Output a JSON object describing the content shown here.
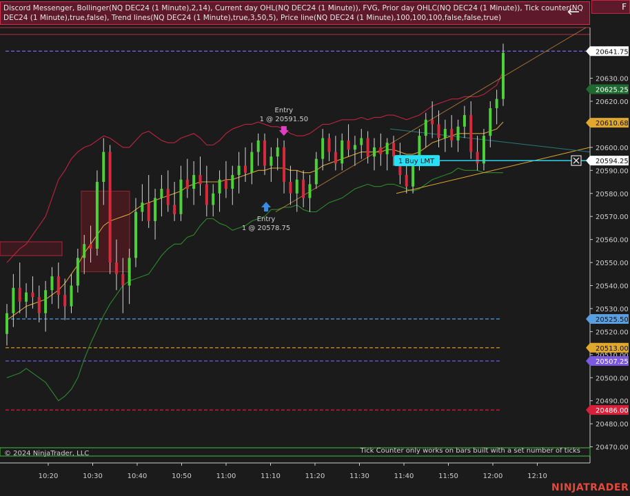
{
  "indicator_bar": {
    "text": "Discord Messenger, Bollinger(NQ DEC24 (1 Minute),2,14), Current day OHL(NQ DEC24 (1 Minute)), FVG, Prior day OHLC(NQ DEC24 (1 Minute)), Tick counter(NQ DEC24 (1 Minute),true,false), Trend lines(NQ DEC24 (1 Minute),true,3,50,5), Price line(NQ DEC24 (1 Minute),100,100,100,false,false,true)"
  },
  "corner_button": {
    "label": "F"
  },
  "back_button": {
    "icon": "arrow-left-icon"
  },
  "copyright": "© 2024 NinjaTrader, LLC",
  "tick_counter_note": "Tick Counter only works on bars built with a set number of ticks",
  "brand": "NINJATRADER",
  "colors": {
    "background": "#1b1b1b",
    "up": "#4cd137",
    "down": "#d62b3d",
    "wick": "#d8d8d8",
    "bb_upper": "#c0243f",
    "bb_mid": "#d4a23a",
    "bb_lower": "#2c8a2c",
    "price_tag": "#ffffff",
    "green_tag": "#1f5e2c",
    "gold_tag": "#e0a82e",
    "blue_tag": "#5aa0e0",
    "purple_tag": "#7b5ae0",
    "red_tag": "#d8203a"
  },
  "chart_data": {
    "type": "candlestick",
    "instrument": "NQ DEC24 (1 Minute)",
    "y_ticks": [
      20470,
      20480,
      20490,
      20500,
      20510,
      20520,
      20530,
      20540,
      20550,
      20560,
      20570,
      20580,
      20590,
      20600,
      20620,
      20630
    ],
    "ylim": [
      20463,
      20652
    ],
    "x_ticks": [
      "10:20",
      "10:30",
      "10:40",
      "10:50",
      "11:00",
      "11:10",
      "11:20",
      "11:30",
      "11:40",
      "11:50",
      "12:00",
      "12:10"
    ],
    "price_tags": [
      {
        "price": 20641.75,
        "label": "20641.75",
        "style": "current"
      },
      {
        "price": 20625.25,
        "label": "20625.25",
        "style": "green"
      },
      {
        "price": 20610.68,
        "label": "20610.68",
        "style": "gold"
      },
      {
        "price": 20594.25,
        "label": "20594.25",
        "style": "order"
      },
      {
        "price": 20525.5,
        "label": "20525.50",
        "style": "blue"
      },
      {
        "price": 20513.0,
        "label": "20513.00",
        "style": "gold"
      },
      {
        "price": 20507.25,
        "label": "20507.25",
        "style": "purple"
      },
      {
        "price": 20486.0,
        "label": "20486.00",
        "style": "red"
      }
    ],
    "horizontal_lines": [
      {
        "price": 20641.75,
        "color": "#7b6ae8",
        "dash": true
      },
      {
        "price": 20525.5,
        "color": "#5aa0e0",
        "dash": true
      },
      {
        "price": 20513.0,
        "color": "#e0a82e",
        "dash": true
      },
      {
        "price": 20507.25,
        "color": "#7b5ae0",
        "dash": true
      },
      {
        "price": 20486.0,
        "color": "#d8203a",
        "dash": true
      }
    ],
    "order": {
      "label": "1  Buy LMT",
      "price": 20594.25
    },
    "executions": [
      {
        "title": "Entry",
        "detail": "1 @ 20591.50",
        "side": "sell",
        "x_time": "11:13",
        "price": 20605
      },
      {
        "title": "Entry",
        "detail": "1 @ 20578.75",
        "side": "buy",
        "x_time": "11:09",
        "price": 20578.75
      }
    ],
    "candles": [
      [
        20519,
        20532,
        20514,
        20528
      ],
      [
        20528,
        20545,
        20522,
        20539
      ],
      [
        20539,
        20550,
        20528,
        20533
      ],
      [
        20533,
        20541,
        20526,
        20537
      ],
      [
        20537,
        20544,
        20530,
        20535
      ],
      [
        20535,
        20540,
        20524,
        20528
      ],
      [
        20528,
        20542,
        20520,
        20538
      ],
      [
        20538,
        20548,
        20532,
        20544
      ],
      [
        20544,
        20550,
        20530,
        20536
      ],
      [
        20536,
        20543,
        20525,
        20531
      ],
      [
        20531,
        20545,
        20528,
        20540
      ],
      [
        20540,
        20556,
        20537,
        20552
      ],
      [
        20552,
        20562,
        20545,
        20558
      ],
      [
        20558,
        20566,
        20550,
        20556
      ],
      [
        20556,
        20590,
        20553,
        20585
      ],
      [
        20585,
        20604,
        20575,
        20598
      ],
      [
        20598,
        20601,
        20545,
        20550
      ],
      [
        20550,
        20560,
        20538,
        20545
      ],
      [
        20545,
        20552,
        20528,
        20540
      ],
      [
        20540,
        20556,
        20532,
        20552
      ],
      [
        20552,
        20578,
        20548,
        20572
      ],
      [
        20572,
        20584,
        20568,
        20576
      ],
      [
        20576,
        20588,
        20565,
        20568
      ],
      [
        20568,
        20582,
        20560,
        20578
      ],
      [
        20578,
        20588,
        20570,
        20582
      ],
      [
        20582,
        20590,
        20572,
        20575
      ],
      [
        20575,
        20585,
        20568,
        20571
      ],
      [
        20571,
        20592,
        20568,
        20586
      ],
      [
        20586,
        20595,
        20578,
        20582
      ],
      [
        20582,
        20594,
        20575,
        20588
      ],
      [
        20588,
        20596,
        20579,
        20584
      ],
      [
        20584,
        20592,
        20570,
        20575
      ],
      [
        20575,
        20584,
        20570,
        20580
      ],
      [
        20580,
        20590,
        20572,
        20586
      ],
      [
        20586,
        20594,
        20578,
        20582
      ],
      [
        20582,
        20592,
        20575,
        20588
      ],
      [
        20588,
        20598,
        20580,
        20592
      ],
      [
        20592,
        20600,
        20585,
        20589
      ],
      [
        20589,
        20602,
        20584,
        20598
      ],
      [
        20598,
        20606,
        20592,
        20603
      ],
      [
        20603,
        20606,
        20588,
        20592
      ],
      [
        20592,
        20600,
        20585,
        20596
      ],
      [
        20596,
        20604,
        20590,
        20600
      ],
      [
        20600,
        20603,
        20580,
        20585
      ],
      [
        20585,
        20592,
        20575,
        20580
      ],
      [
        20580,
        20590,
        20572,
        20586
      ],
      [
        20586,
        20590,
        20574,
        20578
      ],
      [
        20578,
        20588,
        20572,
        20584
      ],
      [
        20584,
        20598,
        20582,
        20595
      ],
      [
        20595,
        20608,
        20590,
        20604
      ],
      [
        20604,
        20606,
        20594,
        20598
      ],
      [
        20598,
        20605,
        20590,
        20593
      ],
      [
        20593,
        20606,
        20590,
        20603
      ],
      [
        20603,
        20610,
        20596,
        20599
      ],
      [
        20599,
        20605,
        20592,
        20601
      ],
      [
        20601,
        20608,
        20595,
        20604
      ],
      [
        20604,
        20607,
        20593,
        20596
      ],
      [
        20596,
        20604,
        20590,
        20600
      ],
      [
        20600,
        20606,
        20592,
        20597
      ],
      [
        20597,
        20604,
        20590,
        20602
      ],
      [
        20602,
        20605,
        20592,
        20596
      ],
      [
        20596,
        20602,
        20584,
        20588
      ],
      [
        20588,
        20596,
        20580,
        20583
      ],
      [
        20583,
        20596,
        20580,
        20593
      ],
      [
        20593,
        20608,
        20590,
        20605
      ],
      [
        20605,
        20615,
        20600,
        20612
      ],
      [
        20612,
        20620,
        20604,
        20610
      ],
      [
        20610,
        20616,
        20600,
        20604
      ],
      [
        20604,
        20612,
        20598,
        20608
      ],
      [
        20608,
        20614,
        20600,
        20603
      ],
      [
        20603,
        20612,
        20598,
        20609
      ],
      [
        20609,
        20618,
        20604,
        20614
      ],
      [
        20614,
        20620,
        20595,
        20598
      ],
      [
        20598,
        20605,
        20590,
        20593
      ],
      [
        20593,
        20608,
        20590,
        20605
      ],
      [
        20605,
        20620,
        20600,
        20617
      ],
      [
        20617,
        20625,
        20610,
        20621
      ],
      [
        20621,
        20645,
        20618,
        20641
      ]
    ],
    "bollinger_upper": [
      20550,
      20553,
      20556,
      20558,
      20562,
      20566,
      20570,
      20578,
      20586,
      20590,
      20595,
      20598,
      20600,
      20601,
      20603,
      20605,
      20604,
      20602,
      20600,
      20600,
      20603,
      20606,
      20607,
      20605,
      20603,
      20602,
      20602,
      20604,
      20605,
      20606,
      20604,
      20601,
      20601,
      20603,
      20606,
      20608,
      20609,
      20610,
      20610,
      20611,
      20610,
      20609,
      20609,
      20608,
      20606,
      20605,
      20605,
      20606,
      20608,
      20610,
      20610,
      20611,
      20612,
      20612,
      20612,
      20613,
      20612,
      20613,
      20613,
      20614,
      20614,
      20613,
      20612,
      20613,
      20614,
      20616,
      20618,
      20619,
      20620,
      20621,
      20621,
      20622,
      20622,
      20622,
      20623,
      20625,
      20627,
      20633
    ],
    "bollinger_mid": [
      20525,
      20527,
      20529,
      20531,
      20532,
      20533,
      20534,
      20536,
      20538,
      20541,
      20545,
      20549,
      20554,
      20558,
      20562,
      20566,
      20568,
      20569,
      20570,
      20571,
      20573,
      20575,
      20576,
      20577,
      20578,
      20579,
      20580,
      20581,
      20583,
      20584,
      20585,
      20585,
      20585,
      20585,
      20586,
      20586,
      20587,
      20588,
      20589,
      20590,
      20590,
      20591,
      20591,
      20591,
      20590,
      20590,
      20589,
      20589,
      20590,
      20592,
      20593,
      20594,
      20595,
      20596,
      20597,
      20598,
      20598,
      20598,
      20598,
      20599,
      20599,
      20598,
      20597,
      20597,
      20598,
      20600,
      20602,
      20603,
      20604,
      20605,
      20606,
      20606,
      20606,
      20606,
      20606,
      20607,
      20608,
      20611
    ],
    "bollinger_lower": [
      20500,
      20501,
      20502,
      20504,
      20502,
      20500,
      20498,
      20494,
      20490,
      20492,
      20495,
      20500,
      20508,
      20515,
      20521,
      20527,
      20532,
      20536,
      20540,
      20542,
      20543,
      20544,
      20545,
      20549,
      20553,
      20556,
      20558,
      20558,
      20561,
      20562,
      20566,
      20569,
      20569,
      20567,
      20566,
      20564,
      20565,
      20566,
      20568,
      20569,
      20570,
      20573,
      20573,
      20574,
      20574,
      20575,
      20573,
      20572,
      20572,
      20574,
      20576,
      20577,
      20578,
      20580,
      20582,
      20583,
      20584,
      20583,
      20583,
      20584,
      20584,
      20583,
      20582,
      20581,
      20582,
      20584,
      20586,
      20587,
      20588,
      20589,
      20591,
      20590,
      20590,
      20590,
      20589,
      20589,
      20589,
      20589
    ]
  }
}
